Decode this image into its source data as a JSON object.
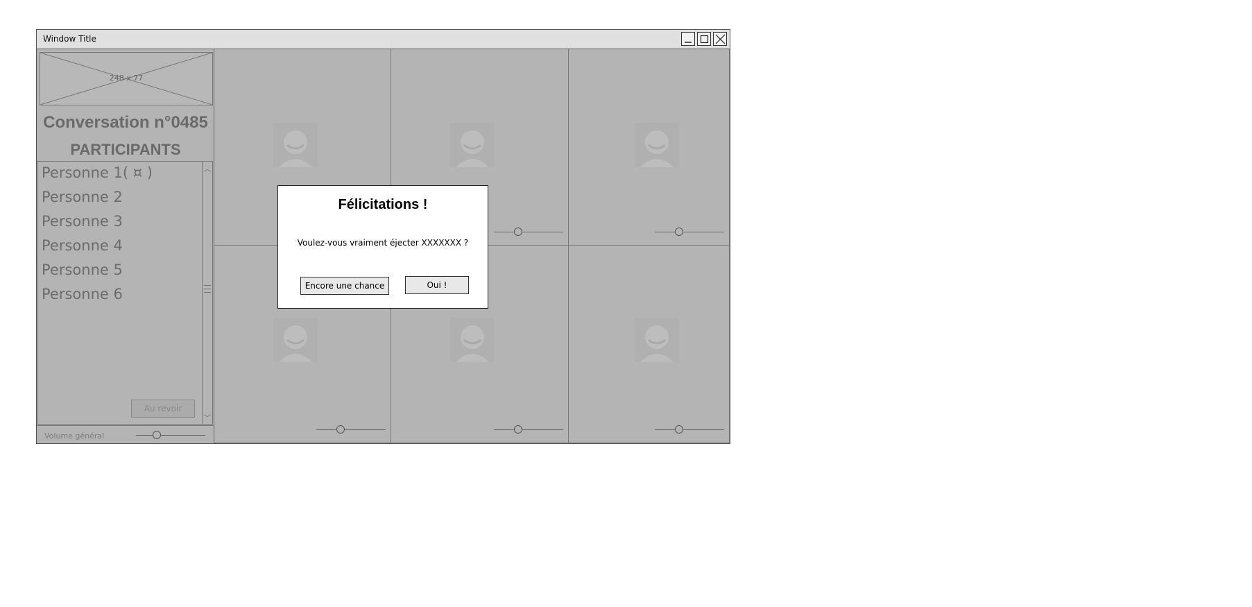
{
  "window": {
    "title": "Window Title",
    "controls": [
      "minimize-icon",
      "maximize-icon",
      "close-icon"
    ]
  },
  "sidebar": {
    "logo_placeholder": "248 x 77",
    "conversation_title": "Conversation n°0485",
    "participants_heading": "PARTICIPANTS",
    "participants": [
      {
        "label": "Personne 1( ¤ )"
      },
      {
        "label": "Personne 2"
      },
      {
        "label": "Personne 3"
      },
      {
        "label": "Personne 4"
      },
      {
        "label": "Personne 5"
      },
      {
        "label": "Personne 6"
      }
    ],
    "leave_button": "Au revoir",
    "volume_label": "Volume général",
    "volume_level": 0.3
  },
  "tiles": [
    {
      "icon": "user-avatar-icon",
      "volume_level": 0.35
    },
    {
      "icon": "user-avatar-icon",
      "volume_level": 0.35
    },
    {
      "icon": "user-avatar-icon",
      "volume_level": 0.35
    },
    {
      "icon": "user-avatar-icon",
      "volume_level": 0.35
    },
    {
      "icon": "user-avatar-icon",
      "volume_level": 0.35
    },
    {
      "icon": "user-avatar-icon",
      "volume_level": 0.35
    }
  ],
  "dialog": {
    "title": "Félicitations !",
    "message": "Voulez-vous vraiment éjecter XXXXXXX ?",
    "cancel_button": "Encore une chance",
    "confirm_button": "Oui !"
  },
  "colors": {
    "overlay_gray": "#b4b4b4",
    "titlebar": "#e0e0e0",
    "dialog_bg": "#ffffff"
  }
}
